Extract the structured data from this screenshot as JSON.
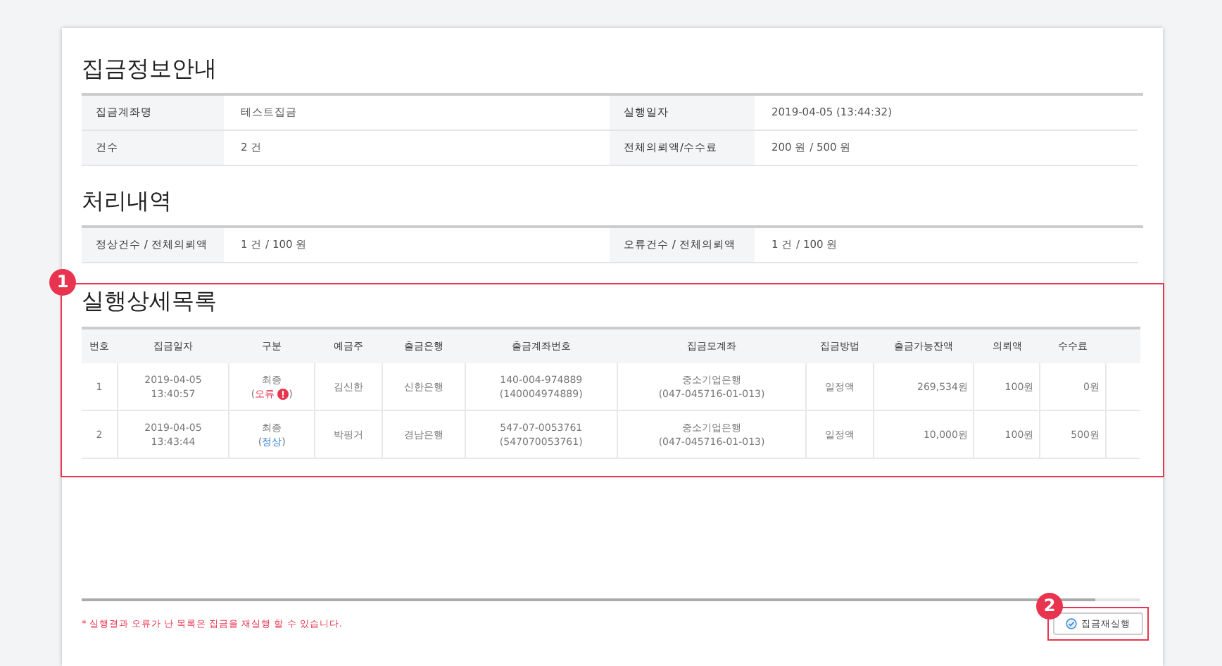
{
  "info": {
    "title": "집금정보안내",
    "rows": [
      [
        {
          "label": "집금계좌명",
          "value": "테스트집금"
        },
        {
          "label": "실행일자",
          "value": "2019-04-05 (13:44:32)"
        }
      ],
      [
        {
          "label": "건수",
          "value": "2 건"
        },
        {
          "label": "전체의뢰액/수수료",
          "value": "200 원 / 500 원"
        }
      ]
    ]
  },
  "processing": {
    "title": "처리내역",
    "rows": [
      [
        {
          "label": "정상건수 / 전체의뢰액",
          "value": "1 건 / 100 원"
        },
        {
          "label": "오류건수 / 전체의뢰액",
          "value": "1 건 / 100 원"
        }
      ]
    ]
  },
  "details": {
    "title": "실행상세목록",
    "badge": "1",
    "columns": [
      "번호",
      "집금일자",
      "구분",
      "예금주",
      "출금은행",
      "출금계좌번호",
      "집금모계좌",
      "집금방법",
      "출금가능잔액",
      "의뢰액",
      "수수료"
    ],
    "rows": [
      {
        "no": "1",
        "date": [
          "2019-04-05",
          "13:40:57"
        ],
        "type": "최종",
        "status": {
          "kind": "error",
          "open": "(",
          "label": "오류",
          "close": ")"
        },
        "holder": "김신한",
        "bank": "신한은행",
        "account": [
          "140-004-974889",
          "(140004974889)"
        ],
        "parent": [
          "중소기업은행",
          "(047-045716-01-013)"
        ],
        "method": "일정액",
        "balance": "269,534원",
        "amount": "100원",
        "fee": "0원"
      },
      {
        "no": "2",
        "date": [
          "2019-04-05",
          "13:43:44"
        ],
        "type": "최종",
        "status": {
          "kind": "normal",
          "open": "(",
          "label": "정상",
          "close": ")"
        },
        "holder": "박핑거",
        "bank": "경남은행",
        "account": [
          "547-07-0053761",
          "(547070053761)"
        ],
        "parent": [
          "중소기업은행",
          "(047-045716-01-013)"
        ],
        "method": "일정액",
        "balance": "10,000원",
        "amount": "100원",
        "fee": "500원"
      }
    ]
  },
  "footer": {
    "note": "* 실행결과 오류가 난 목록은 집금을 재실행 할 수 있습니다.",
    "button": {
      "label": "집금재실행",
      "badge": "2"
    }
  }
}
